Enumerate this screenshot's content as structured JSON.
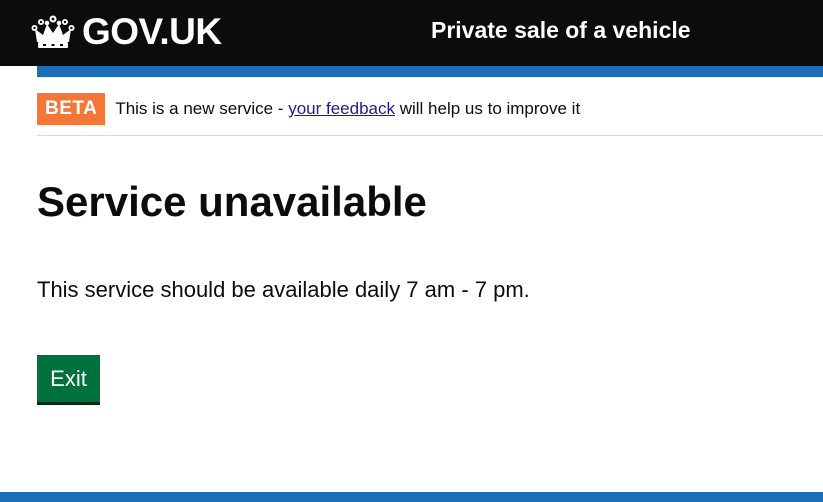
{
  "header": {
    "logo_text": "GOV.UK",
    "service_name": "Private sale of a vehicle",
    "icon": "crown-icon"
  },
  "phase_banner": {
    "tag": "BETA",
    "text_before": "This is a new service - ",
    "link_text": "your feedback",
    "text_after": " will help us to improve it"
  },
  "main": {
    "title": "Service unavailable",
    "body": "This service should be available daily 7 am - 7 pm.",
    "exit_label": "Exit"
  },
  "colors": {
    "header_bg": "#0b0c0c",
    "brand_blue": "#1d70b8",
    "beta_tag": "#f47738",
    "button_green": "#00703c",
    "link": "#1d1d8f"
  }
}
